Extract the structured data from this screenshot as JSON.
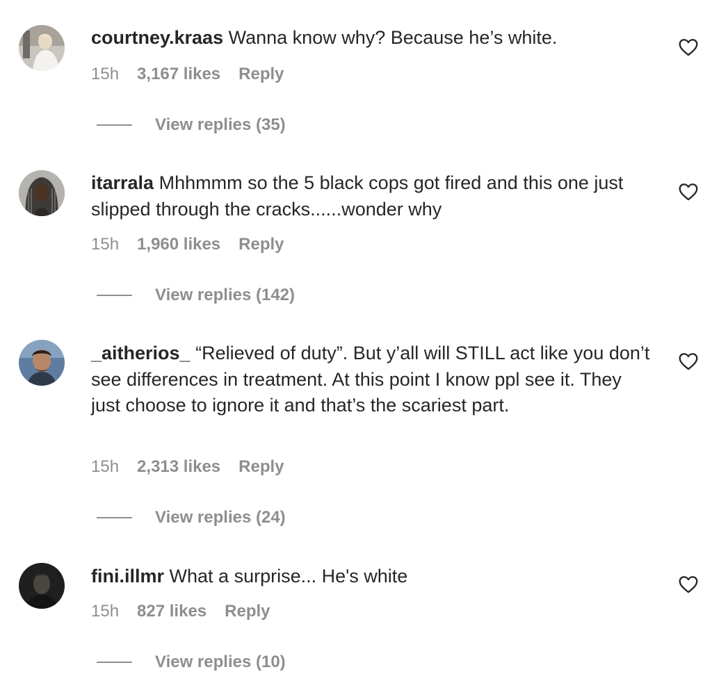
{
  "comments": [
    {
      "username": "courtney.kraas",
      "text": "Wanna know why? Because he’s white.",
      "time": "15h",
      "likes": "3,167 likes",
      "reply": "Reply",
      "view_replies": "View replies (35)",
      "avatar_icon": "profile-photo"
    },
    {
      "username": "itarrala",
      "text": "Mhhmmm so the 5 black cops got fired and this one just slipped through the cracks......wonder why",
      "time": "15h",
      "likes": "1,960 likes",
      "reply": "Reply",
      "view_replies": "View replies (142)",
      "avatar_icon": "profile-photo"
    },
    {
      "username": "_aitherios_",
      "text": "“Relieved of duty”. But y’all will STILL act like you don’t see differences in treatment. At this point I know ppl see it. They just choose to ignore it and that’s the scariest part.",
      "time": "15h",
      "likes": "2,313 likes",
      "reply": "Reply",
      "view_replies": "View replies (24)",
      "avatar_icon": "profile-photo"
    },
    {
      "username": "fini.illmr",
      "text": "What a surprise... He's white",
      "time": "15h",
      "likes": "827 likes",
      "reply": "Reply",
      "view_replies": "View replies (10)",
      "avatar_icon": "profile-photo"
    }
  ],
  "icons": {
    "like": "heart-outline-icon"
  },
  "colors": {
    "text": "#262626",
    "secondary": "#8e8e8e",
    "background": "#ffffff"
  }
}
